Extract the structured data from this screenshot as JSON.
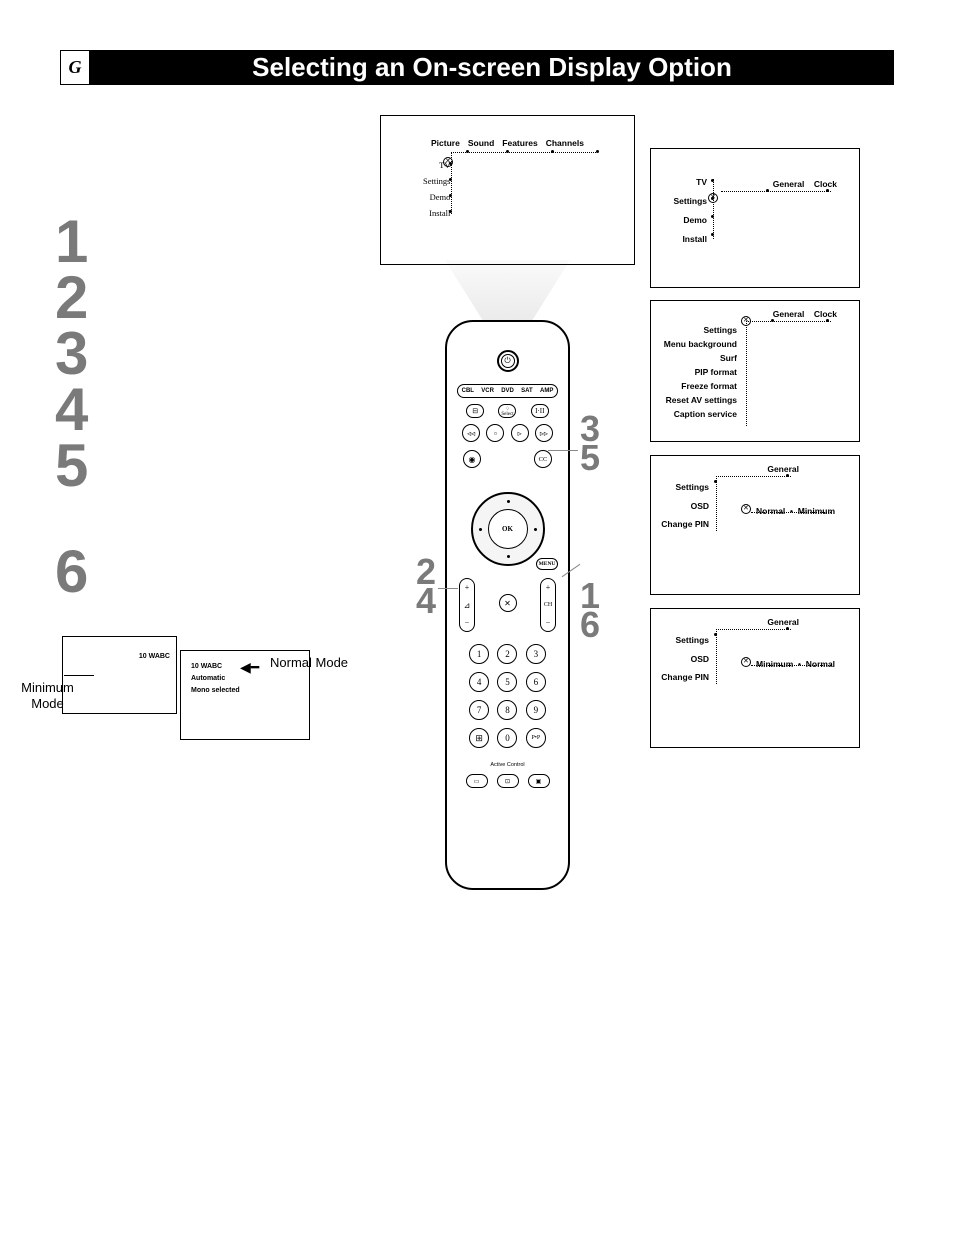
{
  "section_letter": "G",
  "title": "Selecting an On-screen Display Option",
  "steps": [
    "1",
    "2",
    "3",
    "4",
    "5",
    "6"
  ],
  "main_screen": {
    "tabs": [
      "Picture",
      "Sound",
      "Features",
      "Channels"
    ],
    "side": [
      "TV",
      "Settings",
      "Demo",
      "Install"
    ]
  },
  "screens": {
    "sc1": {
      "side": [
        "TV",
        "Settings",
        "Demo",
        "Install"
      ],
      "tabs": [
        "General",
        "Clock"
      ]
    },
    "sc2": {
      "side": [
        "Settings",
        "Menu background",
        "Surf",
        "PIP format",
        "Freeze format",
        "Reset AV settings",
        "Caption service"
      ],
      "tabs": [
        "General",
        "Clock"
      ]
    },
    "sc3": {
      "heading": "General",
      "side": [
        "Settings",
        "OSD",
        "Change PIN"
      ],
      "opts": [
        "Normal",
        "Minimum"
      ]
    },
    "sc4": {
      "heading": "General",
      "side": [
        "Settings",
        "OSD",
        "Change PIN"
      ],
      "opts": [
        "Minimum",
        "Normal"
      ]
    }
  },
  "remote": {
    "modes": [
      "CBL",
      "VCR",
      "DVD",
      "SAT",
      "AMP"
    ],
    "ok": "OK",
    "menu": "MENU",
    "ch": "CH",
    "keypad": [
      "1",
      "2",
      "3",
      "4",
      "5",
      "6",
      "7",
      "8",
      "9",
      "⊞",
      "0",
      "P•P"
    ],
    "active_control": "Active Control",
    "select": "Select"
  },
  "callouts": {
    "left_top": "2",
    "left_bot": "4",
    "r1": "3",
    "r2": "5",
    "r3": "1",
    "r4": "6"
  },
  "mode_diagram": {
    "minimum_label": "Minimum Mode",
    "normal_label": "Normal Mode",
    "minimum_text": "10  WABC",
    "normal_lines": [
      "10  WABC",
      "Automatic",
      "Mono selected"
    ]
  }
}
